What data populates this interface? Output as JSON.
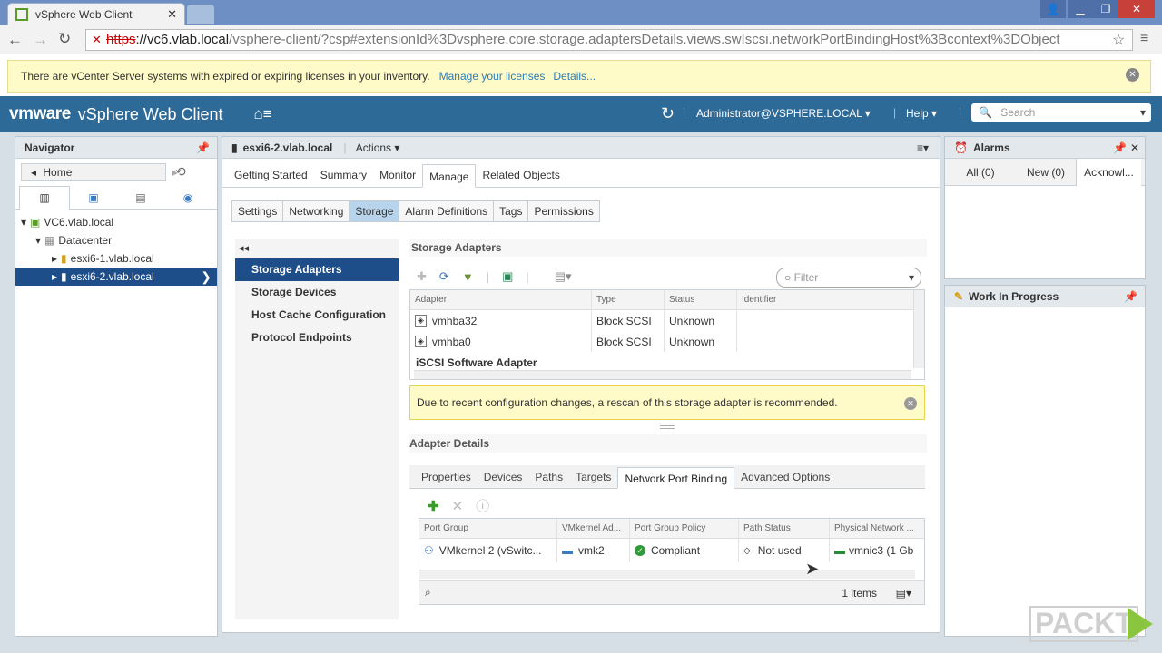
{
  "browser": {
    "tab_title": "vSphere Web Client",
    "url_scheme": "https",
    "url_host": "://vc6.vlab.local",
    "url_path": "/vsphere-client/?csp#extensionId%3Dvsphere.core.storage.adaptersDetails.views.swIscsi.networkPortBindingHost%3Bcontext%3DObject"
  },
  "banner": {
    "text": "There are vCenter Server systems with expired or expiring licenses in your inventory.",
    "link1": "Manage your licenses",
    "link2": "Details..."
  },
  "header": {
    "brand": "vmware",
    "product": "vSphere Web Client",
    "user": "Administrator@VSPHERE.LOCAL",
    "help": "Help",
    "search_placeholder": "Search"
  },
  "navigator": {
    "title": "Navigator",
    "home": "Home",
    "tree": [
      "VC6.vlab.local",
      "Datacenter",
      "esxi6-1.vlab.local",
      "esxi6-2.vlab.local"
    ]
  },
  "object": {
    "name": "esxi6-2.vlab.local",
    "actions": "Actions"
  },
  "tabs": [
    "Getting Started",
    "Summary",
    "Monitor",
    "Manage",
    "Related Objects"
  ],
  "subtabs": [
    "Settings",
    "Networking",
    "Storage",
    "Alarm Definitions",
    "Tags",
    "Permissions"
  ],
  "leftnav": [
    "Storage Adapters",
    "Storage Devices",
    "Host Cache Configuration",
    "Protocol Endpoints"
  ],
  "adapters": {
    "title": "Storage Adapters",
    "filter_placeholder": "Filter",
    "columns": [
      "Adapter",
      "Type",
      "Status",
      "Identifier"
    ],
    "rows": [
      [
        "vmhba32",
        "Block SCSI",
        "Unknown",
        ""
      ],
      [
        "vmhba0",
        "Block SCSI",
        "Unknown",
        ""
      ]
    ],
    "group": "iSCSI Software Adapter"
  },
  "rescan_warning": "Due to recent configuration changes, a rescan of this storage adapter is recommended.",
  "details": {
    "title": "Adapter Details",
    "tabs": [
      "Properties",
      "Devices",
      "Paths",
      "Targets",
      "Network Port Binding",
      "Advanced Options"
    ],
    "columns": [
      "Port Group",
      "VMkernel Ad...",
      "Port Group Policy",
      "Path Status",
      "Physical Network ..."
    ],
    "row": [
      "VMkernel 2 (vSwitc...",
      "vmk2",
      "Compliant",
      "Not used",
      "vmnic3 (1 Gb"
    ],
    "count": "1 items"
  },
  "alarms": {
    "title": "Alarms",
    "tabs": [
      "All (0)",
      "New (0)",
      "Acknowl..."
    ]
  },
  "wip": {
    "title": "Work In Progress"
  },
  "watermark": "PACKT"
}
